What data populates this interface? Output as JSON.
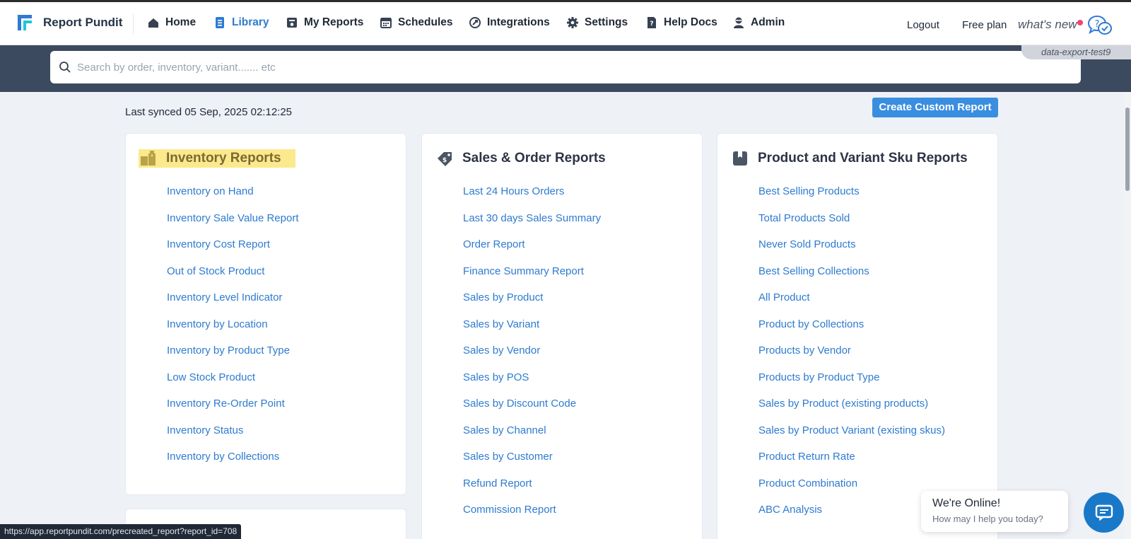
{
  "app": {
    "brand_name": "Report Pundit",
    "accent_color": "#2e7bd0"
  },
  "nav": {
    "items": [
      {
        "label": "Home",
        "icon": "home-icon"
      },
      {
        "label": "Library",
        "icon": "library-icon",
        "active": true
      },
      {
        "label": "My Reports",
        "icon": "my-reports-icon"
      },
      {
        "label": "Schedules",
        "icon": "calendar-icon"
      },
      {
        "label": "Integrations",
        "icon": "integrations-icon"
      },
      {
        "label": "Settings",
        "icon": "gear-icon"
      },
      {
        "label": "Help Docs",
        "icon": "help-doc-icon"
      },
      {
        "label": "Admin",
        "icon": "admin-icon"
      }
    ],
    "logout": "Logout",
    "plan": "Free plan",
    "whats_new": "what's new"
  },
  "search": {
    "placeholder": "Search by order, inventory, variant....... etc",
    "value": ""
  },
  "store_tag": "data-export-test9",
  "synced": "Last synced 05 Sep, 2025 02:12:25",
  "create_button": "Create Custom Report",
  "cards": [
    {
      "title": "Inventory Reports",
      "icon": "inventory-boxes-icon",
      "highlighted": true,
      "reports": [
        "Inventory on Hand",
        "Inventory Sale Value Report",
        "Inventory Cost Report",
        "Out of Stock Product",
        "Inventory Level Indicator",
        "Inventory by Location",
        "Inventory by Product Type",
        "Low Stock Product",
        "Inventory Re-Order Point",
        "Inventory Status",
        "Inventory by Collections"
      ]
    },
    {
      "title": "Sales & Order Reports",
      "icon": "price-tag-icon",
      "reports": [
        "Last 24 Hours Orders",
        "Last 30 days Sales Summary",
        "Order Report",
        "Finance Summary Report",
        "Sales by Product",
        "Sales by Variant",
        "Sales by Vendor",
        "Sales by POS",
        "Sales by Discount Code",
        "Sales by Channel",
        "Sales by Customer",
        "Refund Report",
        "Commission Report"
      ]
    },
    {
      "title": "Product and Variant Sku Reports",
      "icon": "product-bookmark-icon",
      "reports": [
        "Best Selling Products",
        "Total Products Sold",
        "Never Sold Products",
        "Best Selling Collections",
        "All Product",
        "Product by Collections",
        "Products by Vendor",
        "Products by Product Type",
        "Sales by Product (existing products)",
        "Sales by Product Variant (existing skus)",
        "Product Return Rate",
        "Product Combination",
        "ABC Analysis"
      ]
    }
  ],
  "status_url": "https://app.reportpundit.com/precreated_report?report_id=708",
  "chat": {
    "title": "We're Online!",
    "subtitle": "How may I help you today?"
  }
}
